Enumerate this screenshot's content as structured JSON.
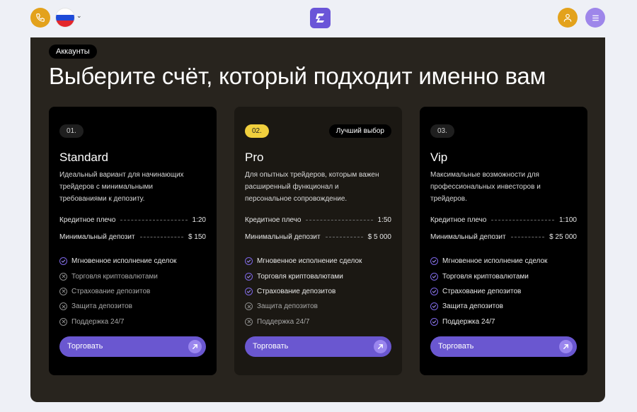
{
  "header": {
    "phone_icon": "phone-icon",
    "language": "ru",
    "flag_colors": [
      "#ffffff",
      "#1f4bd8",
      "#e3262b"
    ],
    "accent": "#e3a21c",
    "brand": "#6a55d8"
  },
  "section": {
    "breadcrumb": "Аккаунты",
    "title": "Выберите счёт, который подходит именно вам"
  },
  "specs_labels": {
    "leverage": "Кредитное плечо",
    "min_deposit": "Минимальный депозит"
  },
  "cards": [
    {
      "number": "01.",
      "title": "Standard",
      "description": "Идеальный вариант для начинающих трейдеров с минимальными требованиями к депозиту.",
      "leverage": "1:20",
      "min_deposit": "$ 150",
      "features": [
        {
          "label": "Мгновенное исполнение сделок",
          "included": true
        },
        {
          "label": "Торговля криптовалютами",
          "included": false
        },
        {
          "label": "Страхование депозитов",
          "included": false
        },
        {
          "label": "Защита депозитов",
          "included": false
        },
        {
          "label": "Поддержка 24/7",
          "included": false
        }
      ],
      "button": "Торговать"
    },
    {
      "number": "02.",
      "badge": "Лучший выбор",
      "title": "Pro",
      "description": "Для опытных трейдеров, которым важен расширенный функционал и персональное сопровождение.",
      "leverage": "1:50",
      "min_deposit": "$ 5 000",
      "features": [
        {
          "label": "Мгновенное исполнение сделок",
          "included": true
        },
        {
          "label": "Торговля криптовалютами",
          "included": true
        },
        {
          "label": "Страхование депозитов",
          "included": true
        },
        {
          "label": "Защита депозитов",
          "included": false
        },
        {
          "label": "Поддержка 24/7",
          "included": false
        }
      ],
      "button": "Торговать"
    },
    {
      "number": "03.",
      "title": "Vip",
      "description": "Максимальные возможности для профессиональных инвесторов и трейдеров.",
      "leverage": "1:100",
      "min_deposit": "$ 25 000",
      "features": [
        {
          "label": "Мгновенное исполнение сделок",
          "included": true
        },
        {
          "label": "Торговля криптовалютами",
          "included": true
        },
        {
          "label": "Страхование депозитов",
          "included": true
        },
        {
          "label": "Защита депозитов",
          "included": true
        },
        {
          "label": "Поддержка 24/7",
          "included": true
        }
      ],
      "button": "Торговать"
    }
  ]
}
